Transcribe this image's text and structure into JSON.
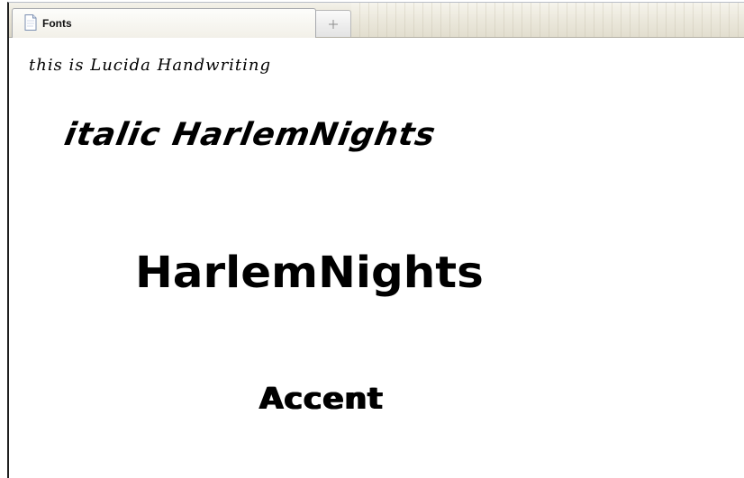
{
  "browser": {
    "tab": {
      "title": "Fonts",
      "icon": "document-icon"
    },
    "new_tab": {
      "icon": "plus-icon"
    }
  },
  "page": {
    "lines": [
      {
        "text": "this is Lucida Handwriting"
      },
      {
        "text": "italic HarlemNights"
      },
      {
        "text": "HarlemNights"
      },
      {
        "text": "Accent"
      }
    ]
  },
  "colors": {
    "text": "#000000",
    "background": "#ffffff",
    "tab_strip": "#e6e2d4",
    "window_edge": "#1f1f1f"
  }
}
